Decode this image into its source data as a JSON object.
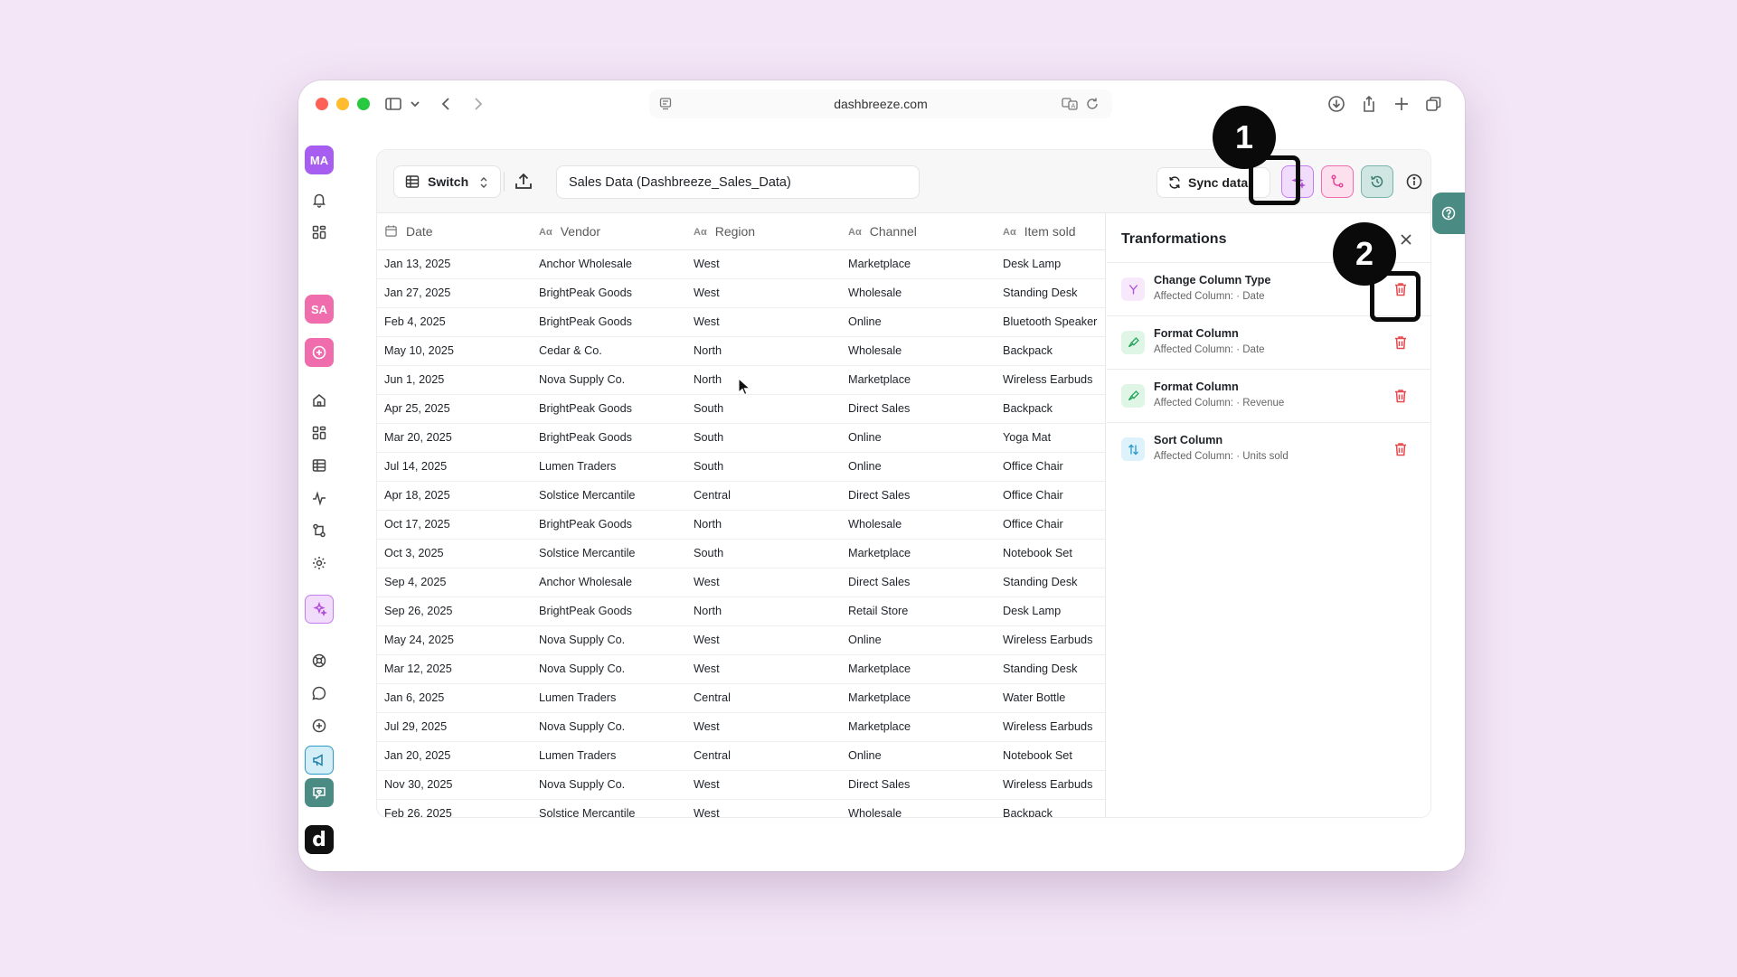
{
  "browser": {
    "url": "dashbreeze.com"
  },
  "sidebar": {
    "avatars": [
      {
        "initials": "MA",
        "color": "#a65df0"
      },
      {
        "initials": "SA",
        "color": "#ef6cad"
      }
    ],
    "items": [
      "bell-icon",
      "widgets-icon",
      "add-circle-icon",
      "home-icon",
      "dashboard-icon",
      "table-icon",
      "activity-icon",
      "transform-icon",
      "settings-icon",
      "magic-icon",
      "help-circle-icon",
      "chat-icon",
      "plus-circle-icon",
      "megaphone-icon",
      "heart-chat-icon"
    ],
    "logo": "d"
  },
  "toolbar": {
    "switch_label": "Switch",
    "dataset_title": "Sales Data (Dashbreeze_Sales_Data)",
    "sync_label": "Sync data"
  },
  "table": {
    "columns": [
      "Date",
      "Vendor",
      "Region",
      "Channel",
      "Item sold"
    ],
    "column_type_icon": "Aα",
    "rows": [
      [
        "Jan 13, 2025",
        "Anchor Wholesale",
        "West",
        "Marketplace",
        "Desk Lamp"
      ],
      [
        "Jan 27, 2025",
        "BrightPeak Goods",
        "West",
        "Wholesale",
        "Standing Desk"
      ],
      [
        "Feb 4, 2025",
        "BrightPeak Goods",
        "West",
        "Online",
        "Bluetooth Speaker"
      ],
      [
        "May 10, 2025",
        "Cedar & Co.",
        "North",
        "Wholesale",
        "Backpack"
      ],
      [
        "Jun 1, 2025",
        "Nova Supply Co.",
        "North",
        "Marketplace",
        "Wireless Earbuds"
      ],
      [
        "Apr 25, 2025",
        "BrightPeak Goods",
        "South",
        "Direct Sales",
        "Backpack"
      ],
      [
        "Mar 20, 2025",
        "BrightPeak Goods",
        "South",
        "Online",
        "Yoga Mat"
      ],
      [
        "Jul 14, 2025",
        "Lumen Traders",
        "South",
        "Online",
        "Office Chair"
      ],
      [
        "Apr 18, 2025",
        "Solstice Mercantile",
        "Central",
        "Direct Sales",
        "Office Chair"
      ],
      [
        "Oct 17, 2025",
        "BrightPeak Goods",
        "North",
        "Wholesale",
        "Office Chair"
      ],
      [
        "Oct 3, 2025",
        "Solstice Mercantile",
        "South",
        "Marketplace",
        "Notebook Set"
      ],
      [
        "Sep 4, 2025",
        "Anchor Wholesale",
        "West",
        "Direct Sales",
        "Standing Desk"
      ],
      [
        "Sep 26, 2025",
        "BrightPeak Goods",
        "North",
        "Retail Store",
        "Desk Lamp"
      ],
      [
        "May 24, 2025",
        "Nova Supply Co.",
        "West",
        "Online",
        "Wireless Earbuds"
      ],
      [
        "Mar 12, 2025",
        "Nova Supply Co.",
        "West",
        "Marketplace",
        "Standing Desk"
      ],
      [
        "Jan 6, 2025",
        "Lumen Traders",
        "Central",
        "Marketplace",
        "Water Bottle"
      ],
      [
        "Jul 29, 2025",
        "Nova Supply Co.",
        "West",
        "Marketplace",
        "Wireless Earbuds"
      ],
      [
        "Jan 20, 2025",
        "Lumen Traders",
        "Central",
        "Online",
        "Notebook Set"
      ],
      [
        "Nov 30, 2025",
        "Nova Supply Co.",
        "West",
        "Direct Sales",
        "Wireless Earbuds"
      ],
      [
        "Feb 26, 2025",
        "Solstice Mercantile",
        "West",
        "Wholesale",
        "Backpack"
      ]
    ]
  },
  "transformations": {
    "title": "Tranformations",
    "items": [
      {
        "name": "Change Column Type",
        "affected_label": "Affected Column:",
        "column": "Date",
        "icon": "change-type-icon",
        "bg": "#f7e8fb",
        "fg": "#b04fd6"
      },
      {
        "name": "Format Column",
        "affected_label": "Affected Column:",
        "column": "Date",
        "icon": "format-brush-icon",
        "bg": "#dff6e6",
        "fg": "#23a35a"
      },
      {
        "name": "Format Column",
        "affected_label": "Affected Column:",
        "column": "Revenue",
        "icon": "format-brush-icon",
        "bg": "#dff6e6",
        "fg": "#23a35a"
      },
      {
        "name": "Sort Column",
        "affected_label": "Affected Column:",
        "column": "Units sold",
        "icon": "sort-icon",
        "bg": "#ddf2fb",
        "fg": "#2a9bc9"
      }
    ]
  },
  "annotations": {
    "step1": "1",
    "step2": "2"
  },
  "colors": {
    "accent_purple": "#c47df0",
    "accent_pink": "#ef6cad",
    "accent_teal": "#4a8c84",
    "delete_red": "#e5484d"
  }
}
